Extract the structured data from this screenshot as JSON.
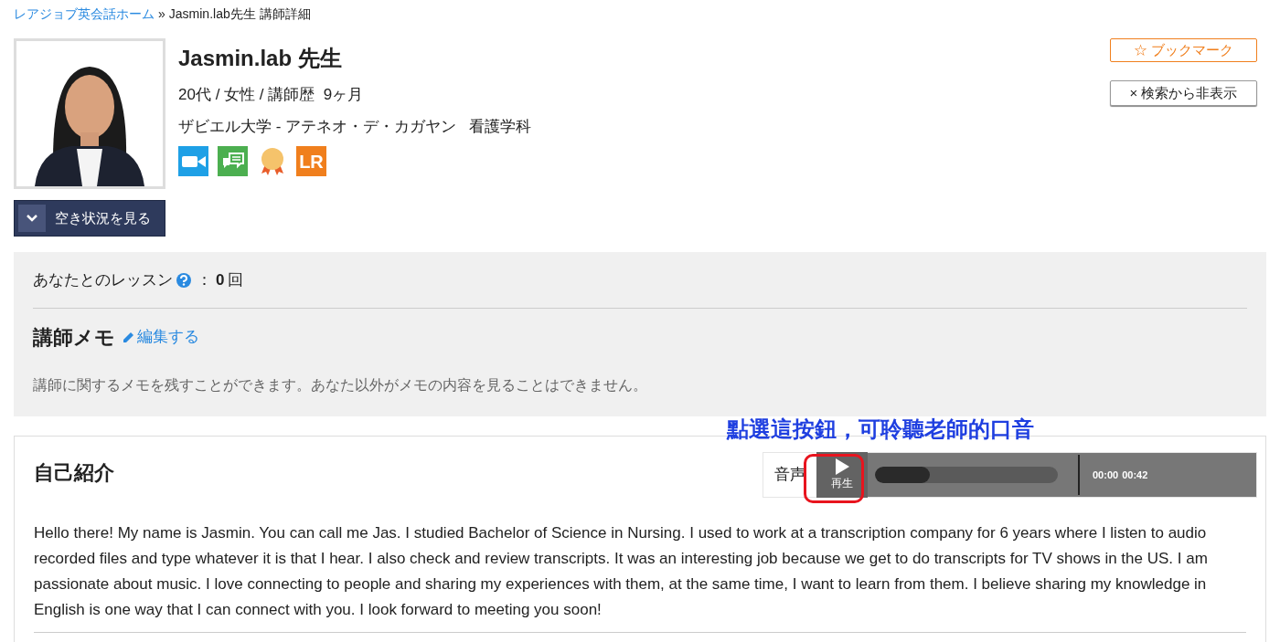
{
  "breadcrumb": {
    "home": "レアジョブ英会話ホーム",
    "separator": "»",
    "current": "Jasmin.lab先生 講師詳細"
  },
  "tutor": {
    "name": "Jasmin.lab 先生",
    "profile": "20代 / 女性 / 講師歴  9ヶ月",
    "education": "ザビエル大学 - アテネオ・デ・カガヤン   看護学科",
    "badges": [
      {
        "kind": "video",
        "color": "#1ea0e6"
      },
      {
        "kind": "chat",
        "color": "#4caf50"
      },
      {
        "kind": "medal",
        "color": "#f5c36b"
      },
      {
        "kind": "text",
        "label": "LR",
        "color": "#f07f1d"
      }
    ]
  },
  "availability_button": "空き状況を見る",
  "bookmark_button": "☆ ブックマーク",
  "hide_button": "× 検索から非表示",
  "lessons": {
    "label": "あなたとのレッスン",
    "separator": "：",
    "count": "0",
    "unit": "回"
  },
  "memo": {
    "title": "講師メモ",
    "edit_link": "編集する",
    "note": "講師に関するメモを残すことができます。あなた以外がメモの内容を見ることはできません。"
  },
  "introduction": {
    "title": "自己紹介",
    "audio": {
      "label": "音声",
      "play_label": "再生",
      "level": 0.3,
      "current_time": "00:00",
      "duration": "00:42"
    },
    "text": "Hello there! My name is Jasmin. You can call me Jas. I studied Bachelor of Science in Nursing. I used to work at a transcription company for 6 years where I listen to audio recorded files and type whatever it is that I hear. I also check and review transcripts. It was an interesting job because we get to do transcripts for TV shows in the US. I am passionate about music. I love connecting to people and sharing my experiences with them, at the same time, I want to learn from them. I believe sharing my knowledge in English is one way that I can connect with you. I look forward to meeting you soon!"
  },
  "annotation": "點選這按鈕，可聆聽老師的口音"
}
